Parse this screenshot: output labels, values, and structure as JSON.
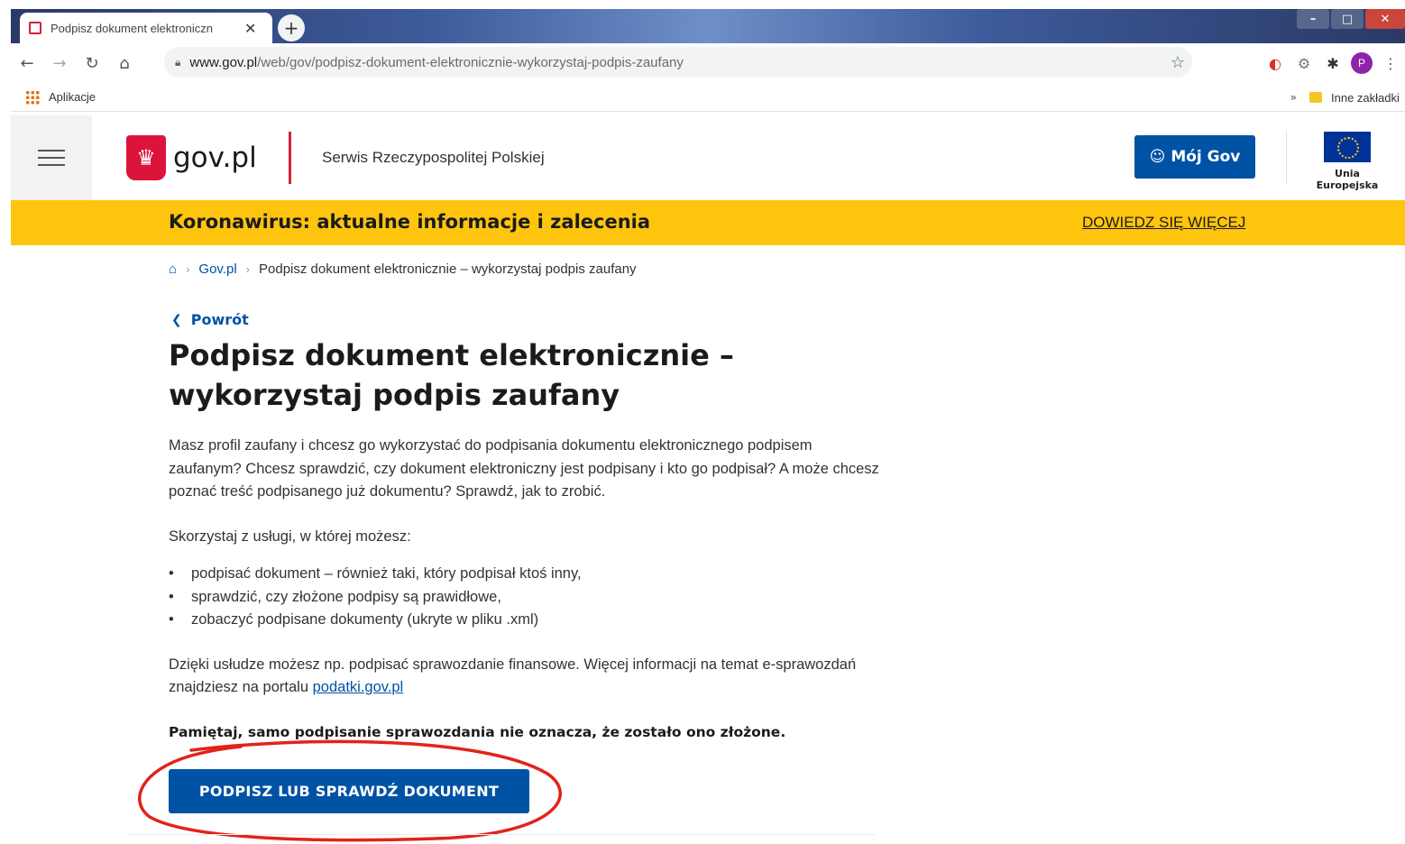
{
  "browser": {
    "tab_title": "Podpisz dokument elektroniczn",
    "tab_close": "✕",
    "new_tab": "+",
    "url_domain": "www.gov.pl",
    "url_path": "/web/gov/podpisz-dokument-elektronicznie-wykorzystaj-podpis-zaufany",
    "profile_initial": "P",
    "bookmarks": {
      "apps_label": "Aplikacje",
      "chevron": "»",
      "other_label": "Inne zakładki"
    }
  },
  "header": {
    "logo_text": "gov.pl",
    "tagline": "Serwis Rzeczypospolitej Polskiej",
    "moj_gov_label": "Mój Gov",
    "eu_label": "Unia Europejska"
  },
  "covid_banner": {
    "text": "Koronawirus: aktualne informacje i zalecenia",
    "link": "DOWIEDZ SIĘ WIĘCEJ"
  },
  "breadcrumb": {
    "home_link": "Gov.pl",
    "current": "Podpisz dokument elektronicznie – wykorzystaj podpis zaufany"
  },
  "page": {
    "back_label": "Powrót",
    "title": "Podpisz dokument elektronicznie – wykorzystaj podpis zaufany",
    "intro": "Masz profil zaufany i chcesz go wykorzystać do podpisania dokumentu elektronicznego podpisem zaufanym? Chcesz sprawdzić, czy dokument elektroniczny jest podpisany i kto go podpisał? A może chcesz poznać treść podpisanego już dokumentu? Sprawdź, jak to zrobić.",
    "list_intro": "Skorzystaj z usługi, w której możesz:",
    "list_items": [
      "podpisać dokument – również taki, który podpisał ktoś inny,",
      "sprawdzić, czy złożone podpisy są prawidłowe,",
      "zobaczyć podpisane dokumenty (ukryte w pliku .xml)"
    ],
    "info_text": "Dzięki usłudze możesz np. podpisać sprawozdanie finansowe. Więcej informacji na temat e-sprawozdań znajdziesz na portalu ",
    "info_link": "podatki.gov.pl",
    "note": "Pamiętaj, samo podpisanie sprawozdania nie oznacza, że zostało ono złożone.",
    "cta_label": "PODPISZ LUB SPRAWDŹ DOKUMENT"
  },
  "colors": {
    "gov_blue": "#0052a5",
    "banner_yellow": "#ffc50e",
    "gov_red": "#d4213d",
    "annotation_red": "#e2231a"
  }
}
